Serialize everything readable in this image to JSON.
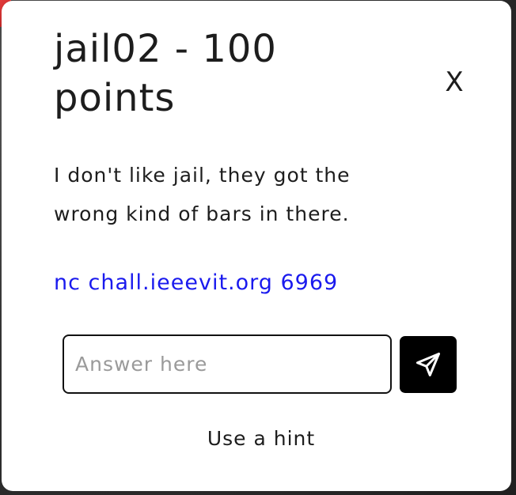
{
  "modal": {
    "title": "jail02 - 100 points",
    "close_label": "X",
    "description": "I don't like jail, they got the wrong kind of bars in there.",
    "connection": "nc chall.ieeevit.org 6969",
    "answer": {
      "placeholder": "Answer here",
      "value": ""
    },
    "submit_icon": "send-icon",
    "hint_label": "Use a hint"
  },
  "colors": {
    "modal_background": "#ffffff",
    "text": "#1d1d1d",
    "link": "#1a1aee",
    "submit_background": "#000000",
    "backdrop_accent": "#e23b3b"
  }
}
